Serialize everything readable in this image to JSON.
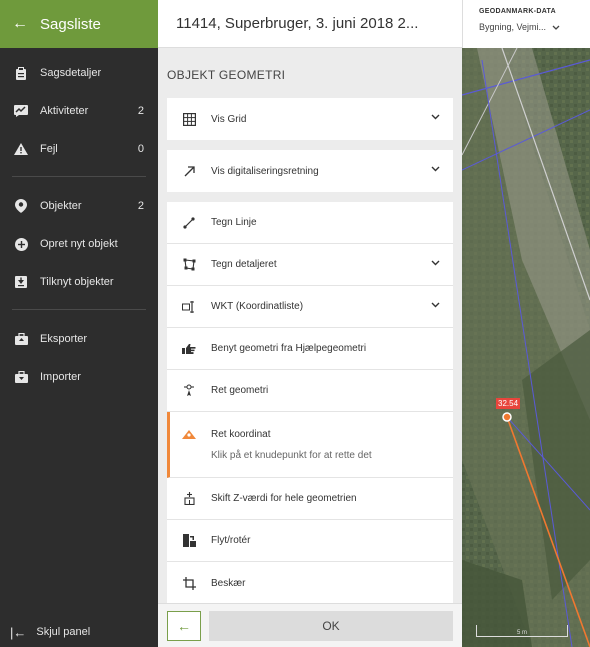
{
  "sidebar": {
    "title": "Sagsliste",
    "items": [
      {
        "label": "Sagsdetaljer",
        "count": ""
      },
      {
        "label": "Aktiviteter",
        "count": "2"
      },
      {
        "label": "Fejl",
        "count": "0"
      },
      {
        "label": "Objekter",
        "count": "2"
      },
      {
        "label": "Opret nyt objekt",
        "count": ""
      },
      {
        "label": "Tilknyt objekter",
        "count": ""
      },
      {
        "label": "Eksporter",
        "count": ""
      },
      {
        "label": "Importer",
        "count": ""
      }
    ],
    "footer": "Skjul panel"
  },
  "panel": {
    "header": "11414, Superbruger, 3. juni 2018 2...",
    "section_title": "OBJEKT GEOMETRI",
    "grid_label": "Vis Grid",
    "dig_label": "Vis digitaliseringsretning",
    "tools": [
      {
        "label": "Tegn Linje"
      },
      {
        "label": "Tegn detaljeret"
      },
      {
        "label": "WKT (Koordinatliste)"
      },
      {
        "label": "Benyt geometri fra Hjælpegeometri"
      },
      {
        "label": "Ret geometri"
      },
      {
        "label": "Ret koordinat",
        "hint": "Klik på et knudepunkt for at rette det"
      },
      {
        "label": "Skift Z-værdi for hele geometrien"
      },
      {
        "label": "Flyt/rotér"
      },
      {
        "label": "Beskær"
      }
    ],
    "back_icon": "←",
    "ok_label": "OK"
  },
  "map": {
    "layer_title": "GEODANMARK-DATA",
    "layer_value": "Bygning, Vejmi...",
    "point_label": "32.54",
    "scale_label": "5 m"
  },
  "colors": {
    "accent_green": "#6f9a3c",
    "sidebar_bg": "#2d2d2d",
    "active_orange": "#f0883a",
    "marker_red": "#e8453c"
  }
}
